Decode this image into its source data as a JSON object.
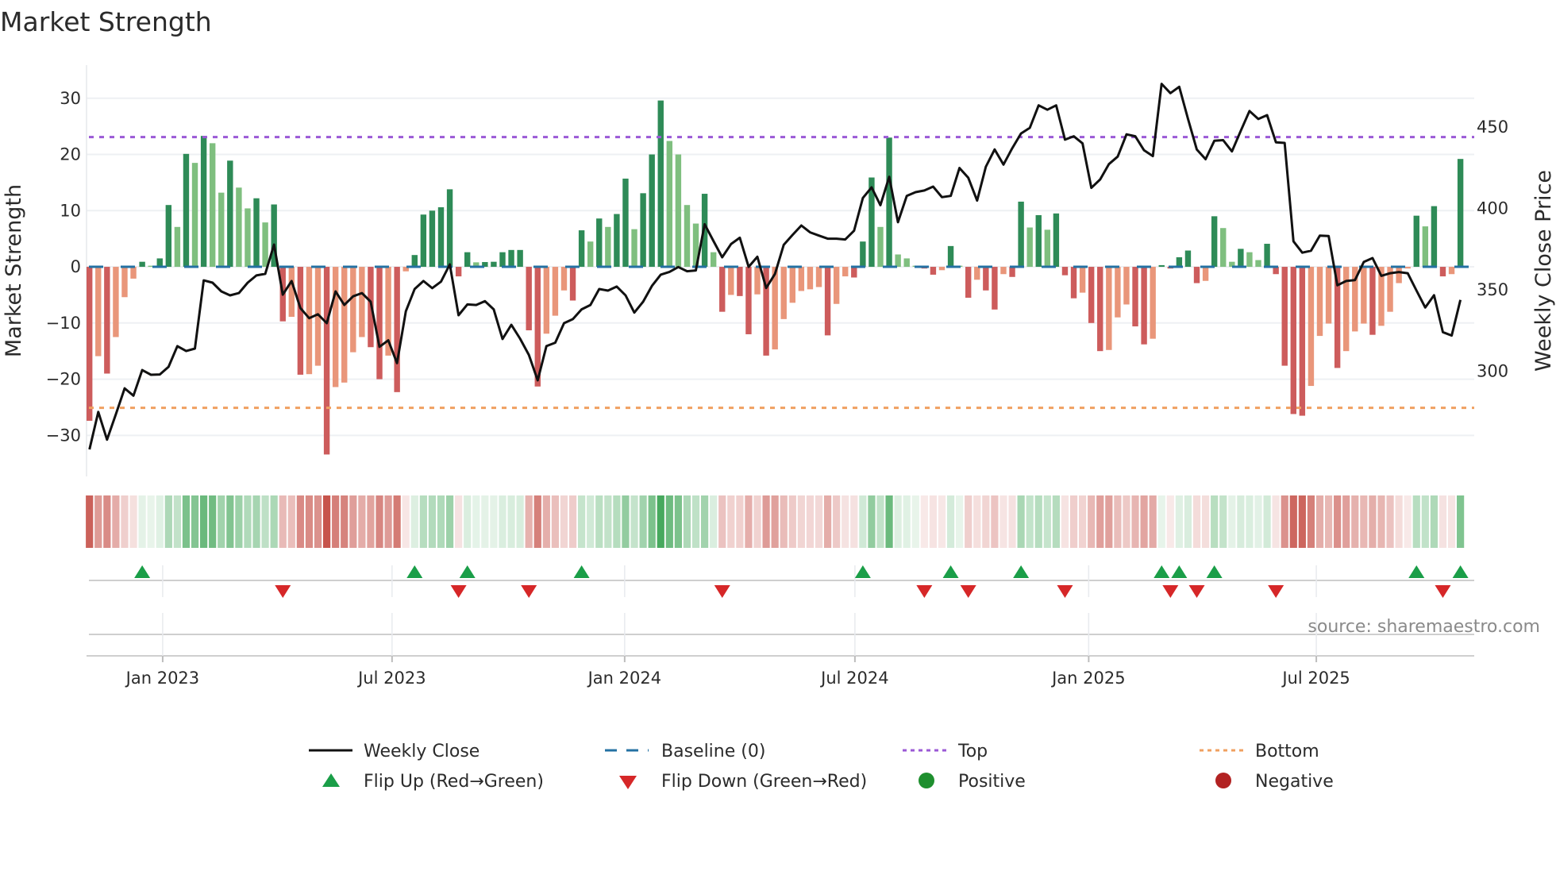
{
  "title": "Market Strength",
  "source": "source: sharemaestro.com",
  "colors": {
    "pos_up": "#2e8b57",
    "pos_down": "#7fbf7f",
    "neg_down": "#cd5c5c",
    "neg_up": "#e9967a",
    "baseline": "#2471a3",
    "top": "#9b59d6",
    "bottom": "#f0a060",
    "price": "#111111",
    "flip_up": "#1a9e48",
    "flip_down": "#d62728",
    "positive": "#1e8f2e",
    "negative": "#b22222"
  },
  "legend": {
    "weekly_close": "Weekly Close",
    "baseline": "Baseline (0)",
    "top": "Top",
    "bottom": "Bottom",
    "flip_up": "Flip Up (Red→Green)",
    "flip_down": "Flip Down (Green→Red)",
    "positive": "Positive",
    "negative": "Negative"
  },
  "chart_data": {
    "type": "bar",
    "title": "Market Strength",
    "ylabel": "Market Strength",
    "y2label": "Weekly Close Price",
    "ylim": [
      -37.3,
      35.9
    ],
    "y2lim": [
      235.4,
      488
    ],
    "top_level": 23.1,
    "bottom_level": -25.1,
    "baseline": 0,
    "grid": true,
    "legend_position": "bottom",
    "y_ticks": [
      {
        "v": 30,
        "label": "30"
      },
      {
        "v": 20,
        "label": "20"
      },
      {
        "v": 10,
        "label": "10"
      },
      {
        "v": 0,
        "label": "0"
      },
      {
        "v": -10,
        "label": "−10"
      },
      {
        "v": -20,
        "label": "−20"
      },
      {
        "v": -30,
        "label": "−30"
      }
    ],
    "y2_ticks": [
      {
        "v": 450,
        "label": "450"
      },
      {
        "v": 400,
        "label": "400"
      },
      {
        "v": 350,
        "label": "350"
      },
      {
        "v": 300,
        "label": "300"
      }
    ],
    "x_ticks": [
      {
        "week": 9.33,
        "label": "Jan 2023"
      },
      {
        "week": 35.43,
        "label": "Jul 2023"
      },
      {
        "week": 61.9,
        "label": "Jan 2024"
      },
      {
        "week": 88.1,
        "label": "Jul 2024"
      },
      {
        "week": 114.7,
        "label": "Jan 2025"
      },
      {
        "week": 140.6,
        "label": "Jul 2025"
      }
    ],
    "strength": [
      -27.4,
      -15.9,
      -19.0,
      -12.5,
      -5.4,
      -2.1,
      0.9,
      0.2,
      1.5,
      11.0,
      7.1,
      20.1,
      18.5,
      23.3,
      22.0,
      13.2,
      18.9,
      14.1,
      10.4,
      12.2,
      7.9,
      11.1,
      -9.7,
      -8.9,
      -19.2,
      -19.1,
      -17.6,
      -33.4,
      -21.4,
      -20.6,
      -15.2,
      -12.5,
      -14.3,
      -20.0,
      -15.8,
      -22.3,
      -0.8,
      2.1,
      9.3,
      10.0,
      10.6,
      13.8,
      -1.7,
      2.6,
      0.8,
      0.85,
      0.9,
      2.6,
      3.0,
      3.0,
      -11.3,
      -21.3,
      -11.9,
      -8.7,
      -4.2,
      -6.0,
      6.5,
      4.5,
      8.6,
      7.1,
      9.4,
      15.7,
      6.7,
      13.1,
      20.0,
      29.6,
      22.4,
      20.0,
      11.0,
      7.7,
      13.0,
      2.6,
      -8.0,
      -5.0,
      -5.2,
      -12.0,
      -4.9,
      -15.8,
      -14.7,
      -9.3,
      -6.4,
      -4.3,
      -4.0,
      -3.6,
      -12.2,
      -6.6,
      -1.7,
      -1.9,
      4.5,
      15.9,
      7.1,
      23.0,
      2.2,
      1.5,
      0.2,
      -0.3,
      -1.4,
      -0.6,
      3.7,
      0.2,
      -5.5,
      -2.3,
      -4.2,
      -7.6,
      -1.3,
      -1.8,
      11.6,
      7.0,
      9.2,
      6.6,
      9.5,
      -1.5,
      -5.6,
      -4.6,
      -10.0,
      -15.0,
      -14.8,
      -9.0,
      -6.7,
      -10.6,
      -13.8,
      -12.8,
      0.3,
      -0.3,
      1.7,
      2.9,
      -2.9,
      -2.5,
      9.0,
      6.9,
      0.9,
      3.2,
      2.6,
      1.2,
      4.1,
      -1.3,
      -17.6,
      -26.2,
      -26.5,
      -21.2,
      -12.3,
      -10.1,
      -18.0,
      -15.0,
      -11.5,
      -10.1,
      -12.1,
      -10.5,
      -8.0,
      -2.9,
      -0.3,
      9.1,
      7.2,
      10.8,
      -1.7,
      -1.3,
      19.2
    ],
    "weekly_close": [
      252,
      275,
      258,
      273.5,
      289.5,
      285,
      300.7,
      297.8,
      298,
      302.7,
      315.4,
      312.4,
      313.9,
      355.8,
      354.4,
      349,
      346.6,
      348,
      354.4,
      358.8,
      359.8,
      377.8,
      347,
      355.4,
      338.8,
      332.6,
      335,
      329.5,
      349,
      340.7,
      346,
      348,
      342.7,
      315,
      319,
      305,
      336.8,
      350.5,
      355.4,
      351,
      355,
      365.6,
      334.4,
      341,
      340.7,
      343,
      338,
      319.8,
      328.5,
      320,
      310,
      294.4,
      315.4,
      317.5,
      329.5,
      332,
      338,
      340.7,
      350.5,
      349.5,
      352,
      346.6,
      336,
      342.7,
      352.4,
      359.3,
      361,
      364,
      361.4,
      361.9,
      390.3,
      380,
      370,
      378.1,
      382,
      364.1,
      370.3,
      351.1,
      359.8,
      377.6,
      383.7,
      389.5,
      385.3,
      383.3,
      381.4,
      381.4,
      380.9,
      386.3,
      406.4,
      412.9,
      402,
      419.4,
      391.5,
      407.7,
      410,
      411,
      413.4,
      406.9,
      407.7,
      424.8,
      418.8,
      404.8,
      425.6,
      436.2,
      426.9,
      437,
      446,
      449.5,
      463.3,
      460.6,
      463.3,
      442.2,
      444.3,
      439.9,
      412.6,
      417.8,
      427.2,
      431.8,
      445.5,
      444.3,
      435.7,
      432.1,
      476.5,
      470.8,
      474.7,
      454.9,
      436.2,
      430.2,
      441.6,
      441.9,
      435,
      447.6,
      459.8,
      454.9,
      457.3,
      440.6,
      440.2,
      379.8,
      372.8,
      374,
      383.3,
      383,
      352.8,
      355.4,
      356,
      367.1,
      369.5,
      358.6,
      360.2,
      360.9,
      360.2,
      349.5,
      339.1,
      346.7,
      324,
      321.9,
      343.8
    ]
  }
}
